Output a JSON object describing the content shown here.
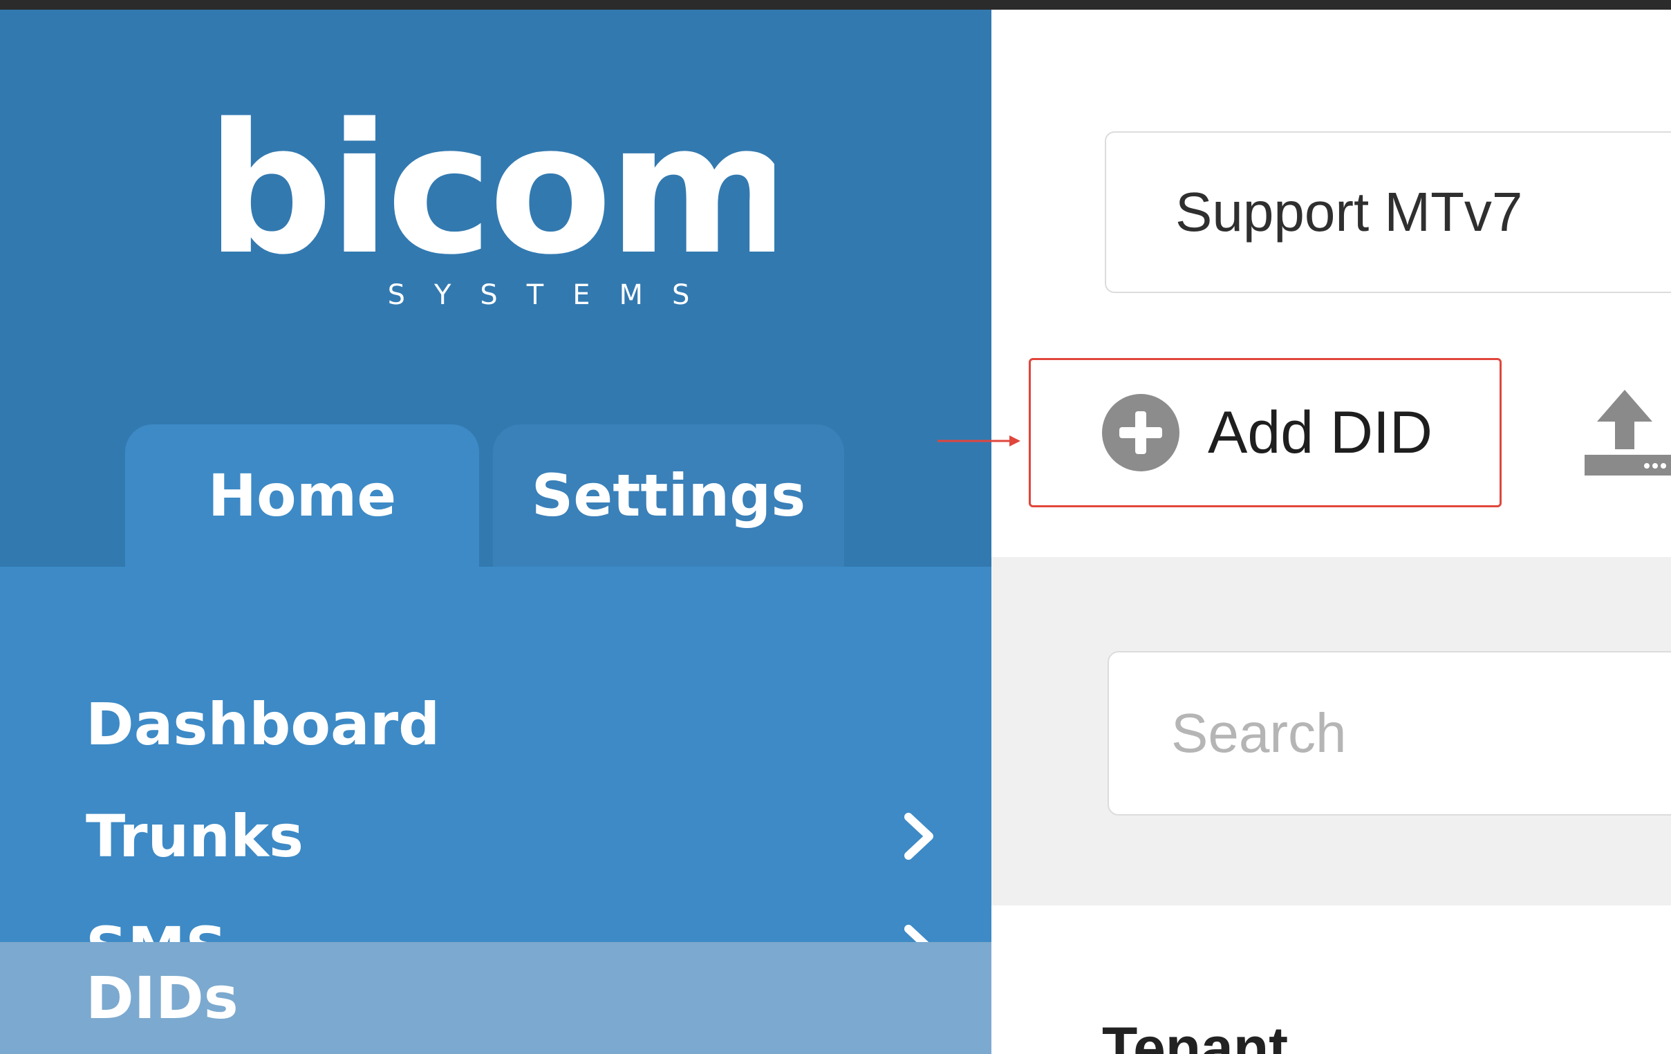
{
  "brand": {
    "name": "bicom",
    "tagline": "SYSTEMS"
  },
  "tabs": [
    {
      "label": "Home",
      "active": true
    },
    {
      "label": "Settings",
      "active": false
    }
  ],
  "menu": [
    {
      "label": "Dashboard",
      "has_submenu": false
    },
    {
      "label": "Trunks",
      "has_submenu": true
    },
    {
      "label": "SMS",
      "has_submenu": true
    },
    {
      "label": "DIDs",
      "has_submenu": false,
      "selected": true
    }
  ],
  "main": {
    "tenant_select": "Support MTv7",
    "add_button_label": "Add DID",
    "search_placeholder": "Search",
    "table_header_first": "Tenant"
  },
  "colors": {
    "sidebar": "#3279b0",
    "menu": "#3d8ac6",
    "selected_item": "#7ca9cf",
    "highlight": "#e0463c"
  },
  "icons": {
    "add": "plus-circle-icon",
    "upload": "upload-icon",
    "chevron": "chevron-right-icon"
  }
}
